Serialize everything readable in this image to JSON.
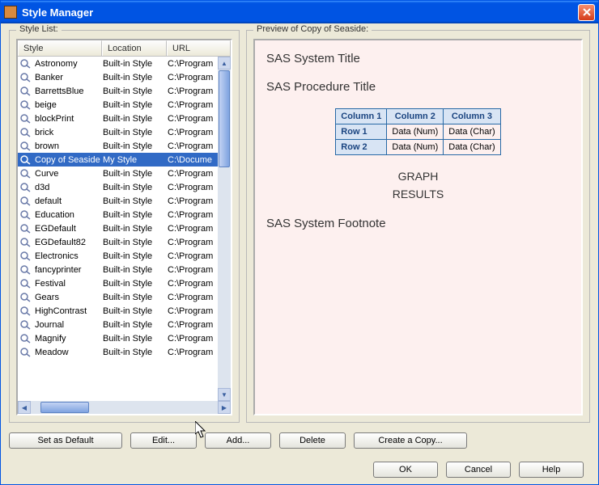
{
  "window": {
    "title": "Style Manager"
  },
  "leftPanel": {
    "title": "Style List:"
  },
  "rightPanel": {
    "title": "Preview of Copy of Seaside:"
  },
  "headers": {
    "style": "Style",
    "location": "Location",
    "url": "URL"
  },
  "styles": [
    {
      "name": "Astronomy",
      "location": "Built-in Style",
      "url": "C:\\Program",
      "selected": false
    },
    {
      "name": "Banker",
      "location": "Built-in Style",
      "url": "C:\\Program",
      "selected": false
    },
    {
      "name": "BarrettsBlue",
      "location": "Built-in Style",
      "url": "C:\\Program",
      "selected": false
    },
    {
      "name": "beige",
      "location": "Built-in Style",
      "url": "C:\\Program",
      "selected": false
    },
    {
      "name": "blockPrint",
      "location": "Built-in Style",
      "url": "C:\\Program",
      "selected": false
    },
    {
      "name": "brick",
      "location": "Built-in Style",
      "url": "C:\\Program",
      "selected": false
    },
    {
      "name": "brown",
      "location": "Built-in Style",
      "url": "C:\\Program",
      "selected": false
    },
    {
      "name": "Copy of Seaside",
      "location": "My Style",
      "url": "C:\\Docume",
      "selected": true
    },
    {
      "name": "Curve",
      "location": "Built-in Style",
      "url": "C:\\Program",
      "selected": false
    },
    {
      "name": "d3d",
      "location": "Built-in Style",
      "url": "C:\\Program",
      "selected": false
    },
    {
      "name": "default",
      "location": "Built-in Style",
      "url": "C:\\Program",
      "selected": false
    },
    {
      "name": "Education",
      "location": "Built-in Style",
      "url": "C:\\Program",
      "selected": false
    },
    {
      "name": "EGDefault",
      "location": "Built-in Style",
      "url": "C:\\Program",
      "selected": false
    },
    {
      "name": "EGDefault82",
      "location": "Built-in Style",
      "url": "C:\\Program",
      "selected": false
    },
    {
      "name": "Electronics",
      "location": "Built-in Style",
      "url": "C:\\Program",
      "selected": false
    },
    {
      "name": "fancyprinter",
      "location": "Built-in Style",
      "url": "C:\\Program",
      "selected": false
    },
    {
      "name": "Festival",
      "location": "Built-in Style",
      "url": "C:\\Program",
      "selected": false
    },
    {
      "name": "Gears",
      "location": "Built-in Style",
      "url": "C:\\Program",
      "selected": false
    },
    {
      "name": "HighContrast",
      "location": "Built-in Style",
      "url": "C:\\Program",
      "selected": false
    },
    {
      "name": "Journal",
      "location": "Built-in Style",
      "url": "C:\\Program",
      "selected": false
    },
    {
      "name": "Magnify",
      "location": "Built-in Style",
      "url": "C:\\Program",
      "selected": false
    },
    {
      "name": "Meadow",
      "location": "Built-in Style",
      "url": "C:\\Program",
      "selected": false
    }
  ],
  "preview": {
    "systemTitle": "SAS System Title",
    "procTitle": "SAS Procedure Title",
    "cols": [
      "Column 1",
      "Column 2",
      "Column 3"
    ],
    "rows": [
      {
        "h": "Row 1",
        "c2": "Data (Num)",
        "c3": "Data (Char)"
      },
      {
        "h": "Row 2",
        "c2": "Data (Num)",
        "c3": "Data (Char)"
      }
    ],
    "graph": "GRAPH",
    "results": "RESULTS",
    "footnote": "SAS System Footnote"
  },
  "buttons": {
    "setDefault": "Set as Default",
    "edit": "Edit...",
    "add": "Add...",
    "delete": "Delete",
    "copy": "Create a Copy...",
    "ok": "OK",
    "cancel": "Cancel",
    "help": "Help"
  }
}
